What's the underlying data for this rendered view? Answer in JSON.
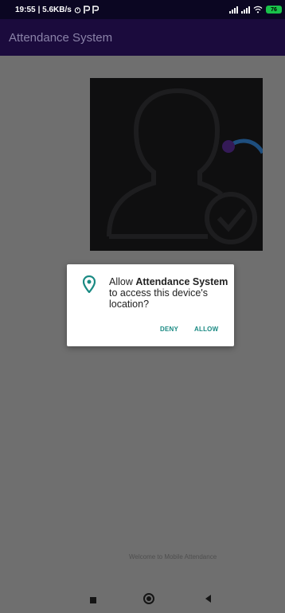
{
  "status_bar": {
    "time": "19:55",
    "speed": "| 5.6KB/s",
    "battery": "76"
  },
  "app_bar": {
    "title": "Attendance System"
  },
  "main": {
    "welcome_text": "Welcome to Mobile Attendance"
  },
  "dialog": {
    "message_prefix": "Allow ",
    "app_name": "Attendance System",
    "message_suffix": " to access this device's location?",
    "deny_label": "DENY",
    "allow_label": "ALLOW",
    "accent_color": "#1a8a83"
  },
  "icons": {
    "dialog": "location-pin-icon",
    "hero": "user-verified-icon"
  }
}
